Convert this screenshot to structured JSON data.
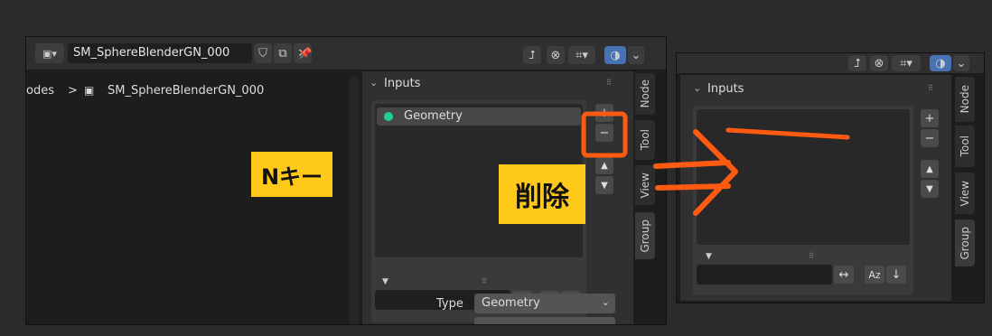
{
  "left_window": {
    "header": {
      "tree_name": "SM_SphereBlenderGN_000"
    },
    "breadcrumb": {
      "prefix": "odes",
      "sep": ">",
      "tree_name": "SM_SphereBlenderGN_000"
    },
    "sidebar": {
      "inputs_title": "Inputs",
      "items": [
        "Geometry"
      ],
      "add_label": "+",
      "remove_label": "−",
      "up_label": "▲",
      "down_label": "▼",
      "type_label": "Type",
      "type_value": "Geometry",
      "tabs": [
        "Node",
        "Tool",
        "View",
        "Group"
      ]
    }
  },
  "right_window": {
    "sidebar": {
      "inputs_title": "Inputs",
      "add_label": "+",
      "remove_label": "−",
      "up_label": "▲",
      "down_label": "▼",
      "tabs": [
        "Node",
        "Tool",
        "View",
        "Group"
      ]
    }
  },
  "annotations": {
    "n_key": "Nキー",
    "delete": "削除",
    "note_yellow": "#ffc91a",
    "note_orange": "#ff5a12"
  },
  "colors": {
    "socket_green": "#1fcf9a",
    "active_blue": "#4772b3"
  }
}
